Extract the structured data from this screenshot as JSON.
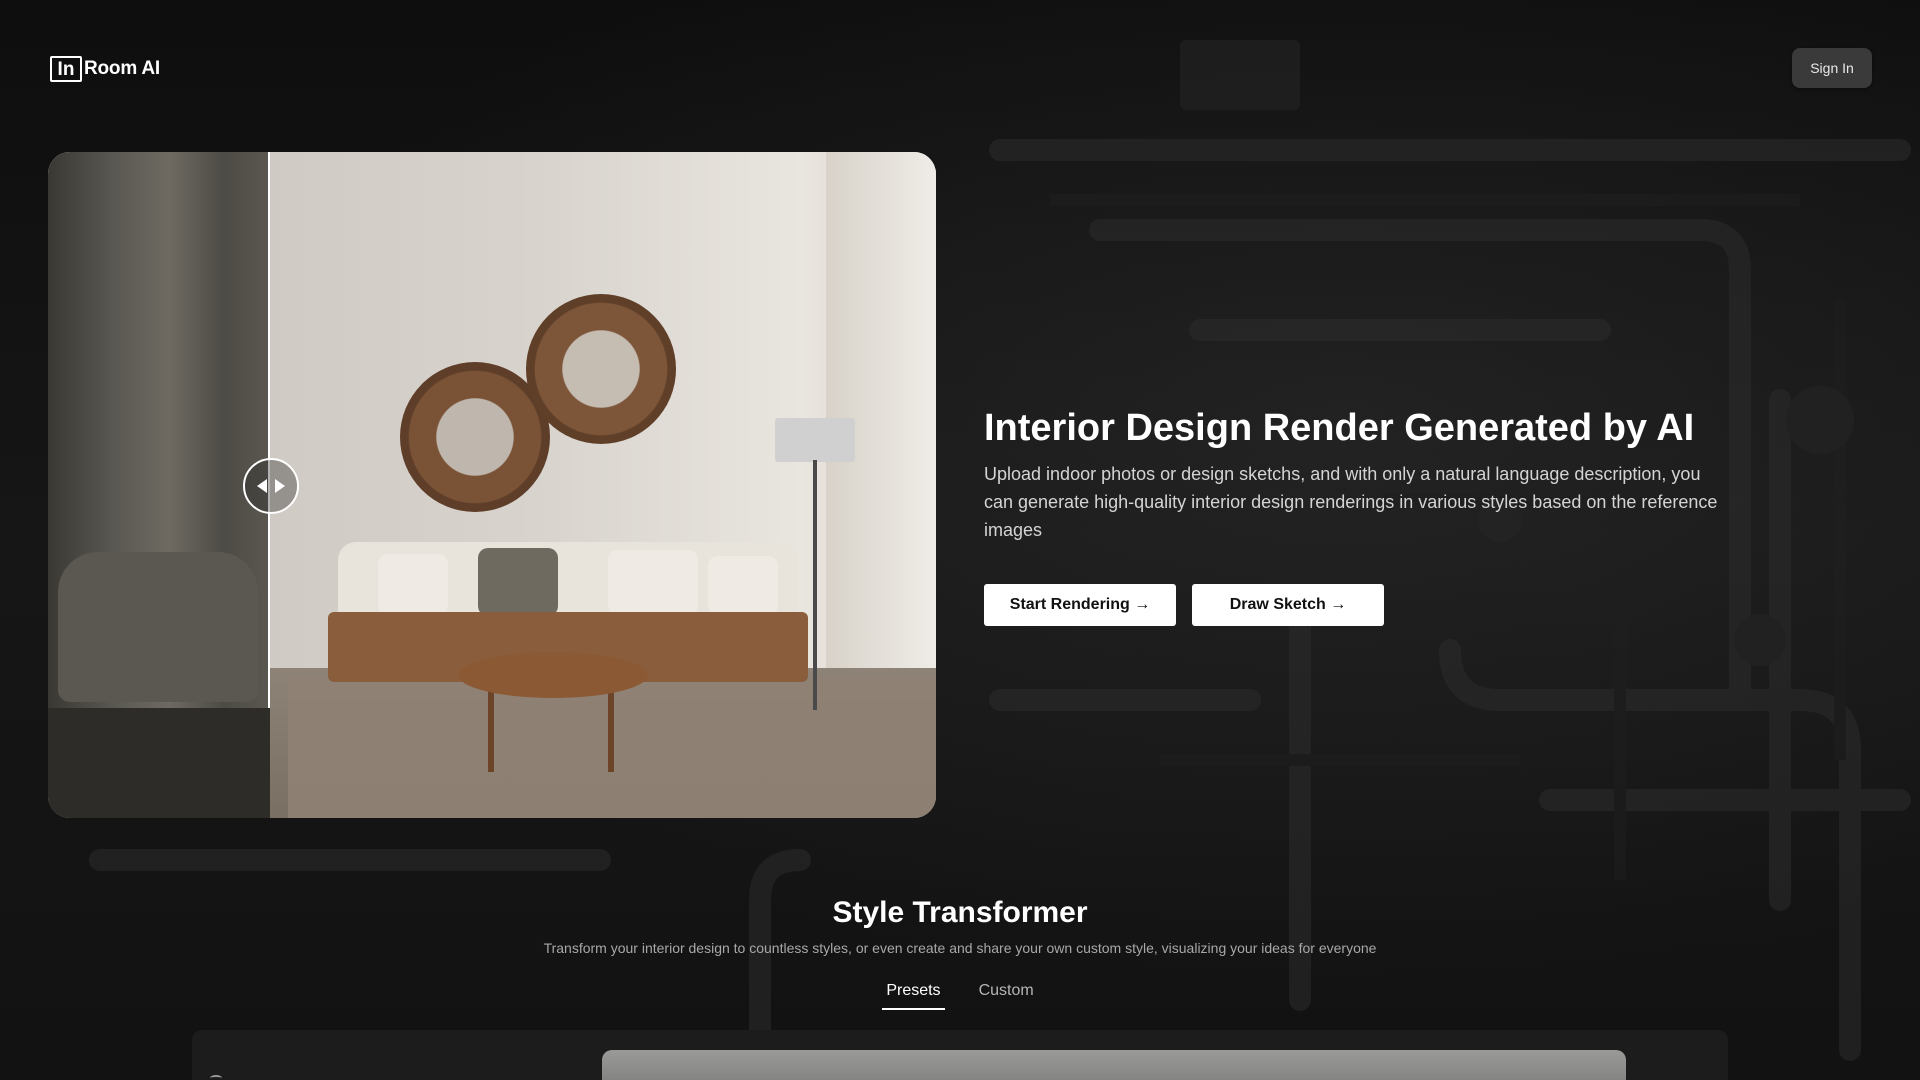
{
  "brand": {
    "logo_mark": "In",
    "logo_text": "Room AI"
  },
  "header": {
    "signin_label": "Sign In"
  },
  "hero": {
    "title": "Interior Design Render Generated by AI",
    "description": "Upload indoor photos or design sketchs, and with only a natural language description, you can generate high-quality interior design renderings in various styles based on the reference images",
    "buttons": {
      "start_label": "Start Rendering →",
      "sketch_label": "Draw Sketch →"
    }
  },
  "comparison": {
    "handle_icon": "compare-slider-icon",
    "split_fraction": 0.25
  },
  "style_transformer": {
    "title": "Style Transformer",
    "subtitle": "Transform your interior design to countless styles, or even create and share your own custom style, visualizing your ideas for everyone",
    "tabs": [
      {
        "label": "Presets",
        "active": true
      },
      {
        "label": "Custom",
        "active": false
      }
    ]
  },
  "colors": {
    "background": "#0b0b0b",
    "button_bg": "#ffffff",
    "signin_bg": "#3a3a3a"
  }
}
